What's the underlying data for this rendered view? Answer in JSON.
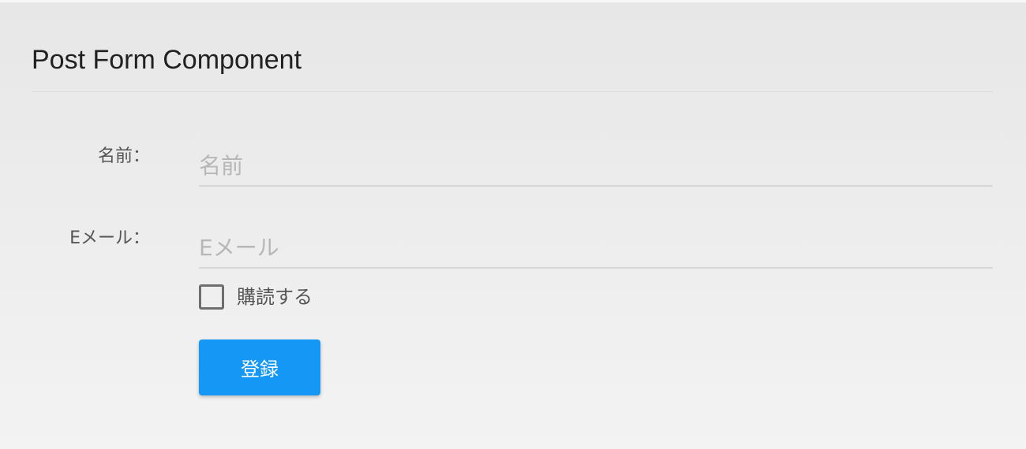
{
  "header": {
    "title": "Post Form Component"
  },
  "form": {
    "name_label": "名前：",
    "name_placeholder": "名前",
    "name_value": "",
    "email_label": "Eメール：",
    "email_placeholder": "Eメール",
    "email_value": "",
    "subscribe_label": "購読する",
    "subscribe_checked": false,
    "submit_label": "登録"
  },
  "colors": {
    "accent": "#1598f5",
    "title_text": "#212121",
    "label_text": "#555555",
    "placeholder_text": "#b7b7b7",
    "input_underline": "#d7d7d7",
    "checkbox_border": "#6e6e6e"
  }
}
